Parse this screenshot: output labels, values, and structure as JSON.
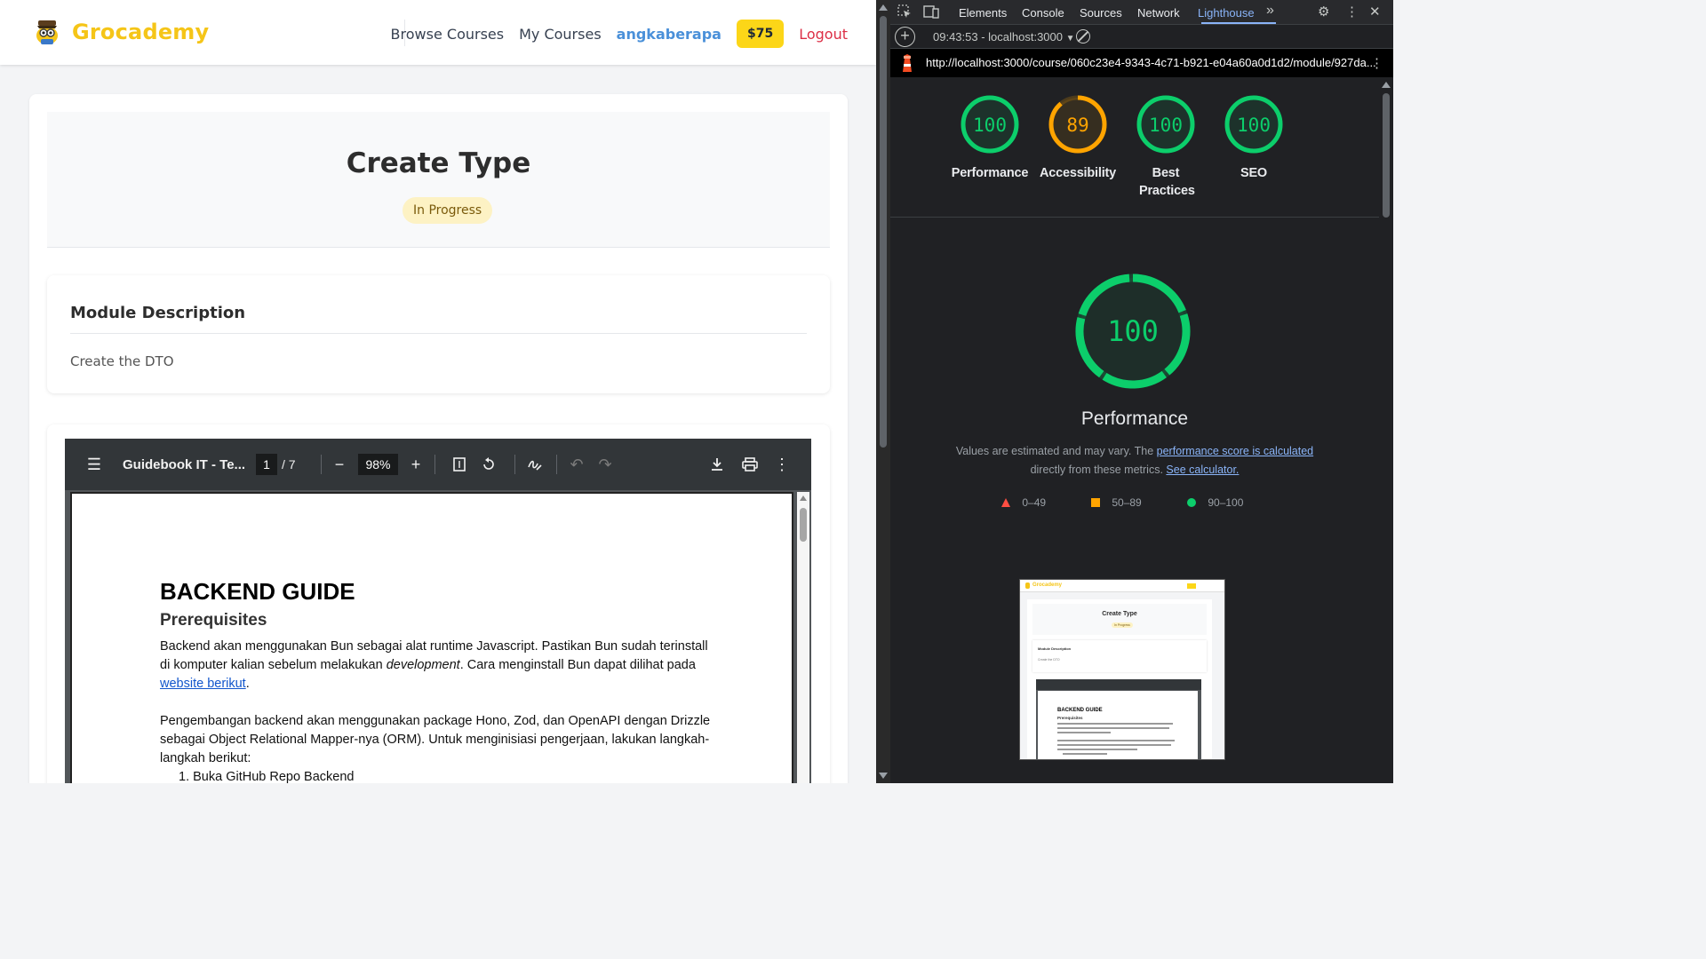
{
  "app": {
    "brand": "Grocademy",
    "nav": {
      "browse": "Browse Courses",
      "my_courses": "My Courses",
      "username": "angkaberapa",
      "balance": "$75",
      "logout": "Logout"
    },
    "module": {
      "title": "Create Type",
      "status": "In Progress"
    },
    "description": {
      "heading": "Module Description",
      "text": "Create the DTO"
    },
    "pdf": {
      "file_name": "Guidebook IT - Te...",
      "current_page": "1",
      "total_pages": "/  7",
      "zoom": "98%",
      "doc": {
        "h1": "BACKEND GUIDE",
        "h2": "Prerequisites",
        "p1_a": "Backend akan menggunakan Bun sebagai alat runtime Javascript. Pastikan Bun sudah terinstall di komputer kalian sebelum melakukan ",
        "p1_em": "development",
        "p1_b": ". Cara menginstall Bun dapat dilihat pada ",
        "p1_link": "website berikut",
        "p1_c": ".",
        "p2": "Pengembangan backend akan menggunakan package Hono, Zod, dan OpenAPI dengan Drizzle sebagai Object Relational Mapper-nya (ORM). Untuk menginisiasi pengerjaan, lakukan langkah-langkah berikut:",
        "list_item_1": "1.    Buka GitHub Repo Backend"
      }
    }
  },
  "devtools": {
    "tabs": [
      "Elements",
      "Console",
      "Sources",
      "Network",
      "Lighthouse"
    ],
    "active_tab": "Lighthouse",
    "session": "09:43:53 - localhost:3000",
    "url": "http://localhost:3000/course/060c23e4-9343-4c71-b921-e04a60a0d1d2/module/927da...",
    "scores": [
      {
        "label": "Performance",
        "value": 100,
        "color": "#0cce6b"
      },
      {
        "label": "Accessibility",
        "value": 89,
        "color": "#ffa400"
      },
      {
        "label": "Best Practices",
        "value": 100,
        "color": "#0cce6b"
      },
      {
        "label": "SEO",
        "value": 100,
        "color": "#0cce6b"
      }
    ],
    "main_score": {
      "label": "Performance",
      "value": 100,
      "color": "#0cce6b"
    },
    "note_a": "Values are estimated and may vary. The ",
    "note_link1": "performance score is calculated",
    "note_b": "directly from these metrics. ",
    "note_link2": "See calculator.",
    "legend": [
      {
        "range": "0–49",
        "color": "#ff4e42",
        "shape": "triangle"
      },
      {
        "range": "50–89",
        "color": "#ffa400",
        "shape": "square"
      },
      {
        "range": "90–100",
        "color": "#0cce6b",
        "shape": "circle"
      }
    ],
    "thumbnail": {
      "brand": "Grocademy",
      "title": "Create Type",
      "status": "In Progress",
      "desc_heading": "Module Description",
      "desc_text": "Create the DTO",
      "doc_h1": "BACKEND GUIDE",
      "doc_h2": "Prerequisites"
    }
  }
}
